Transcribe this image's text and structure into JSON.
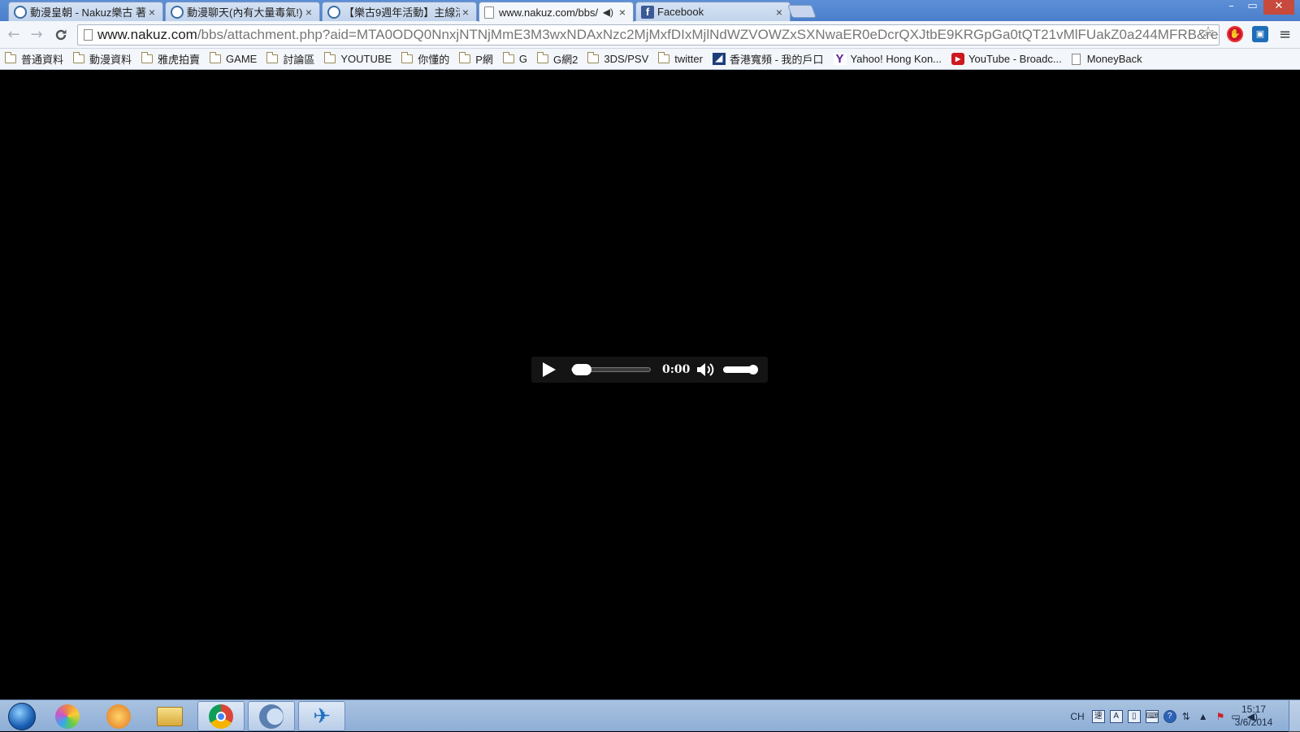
{
  "tabs": [
    {
      "label": "動漫皇朝 - Nakuz樂古 著",
      "icon": "nakuz-favicon",
      "active": false
    },
    {
      "label": "動漫聊天(內有大量毒氣!)",
      "icon": "nakuz-favicon",
      "active": false
    },
    {
      "label": "【樂古9週年活動】主線活",
      "icon": "nakuz-favicon",
      "active": false
    },
    {
      "label": "www.nakuz.com/bbs/",
      "icon": "page-favicon",
      "active": true,
      "playing_audio": true
    },
    {
      "label": "Facebook",
      "icon": "facebook-favicon",
      "active": false
    }
  ],
  "tab_close_glyph": "×",
  "window_controls": {
    "minimize": "–",
    "maximize": "▭",
    "close": "✕"
  },
  "toolbar": {
    "back": "←",
    "forward": "→",
    "reload": "C",
    "url_host": "www.nakuz.com",
    "url_path": "/bbs/attachment.php?aid=MTA0ODQ0NnxjNTNjMmE3M3wxNDAxNzc2MjMxfDIxMjlNdWZVOWZxSXNwaER0eDcrQXJtbE9KRGpGa0tQT21vMlFUakZ0a244MFRB&re",
    "star": "☆",
    "menu": "≡"
  },
  "bookmarks": [
    {
      "label": "普通資料",
      "type": "folder"
    },
    {
      "label": "動漫資料",
      "type": "folder"
    },
    {
      "label": "雅虎拍賣",
      "type": "folder"
    },
    {
      "label": "GAME",
      "type": "folder"
    },
    {
      "label": "討論區",
      "type": "folder"
    },
    {
      "label": "YOUTUBE",
      "type": "folder"
    },
    {
      "label": "你懂的",
      "type": "folder"
    },
    {
      "label": "P網",
      "type": "folder"
    },
    {
      "label": "G",
      "type": "folder"
    },
    {
      "label": "G網2",
      "type": "folder"
    },
    {
      "label": "3DS/PSV",
      "type": "folder"
    },
    {
      "label": "twitter",
      "type": "folder"
    },
    {
      "label": "香港寬頻 - 我的戶口",
      "type": "link"
    },
    {
      "label": "Yahoo! Hong Kon...",
      "type": "link"
    },
    {
      "label": "YouTube - Broadc...",
      "type": "link"
    },
    {
      "label": "MoneyBack",
      "type": "link"
    }
  ],
  "audio_player": {
    "time": "0:00",
    "progress_fraction": 0.0,
    "volume_fraction": 1.0
  },
  "taskbar": {
    "language": "CH",
    "clock_time": "15:17",
    "clock_date": "3/6/2014"
  },
  "colors": {
    "tabstrip": "#5c8fd6",
    "page_background": "#000000",
    "player_background": "#141414",
    "taskbar": "#a9c2e0"
  }
}
